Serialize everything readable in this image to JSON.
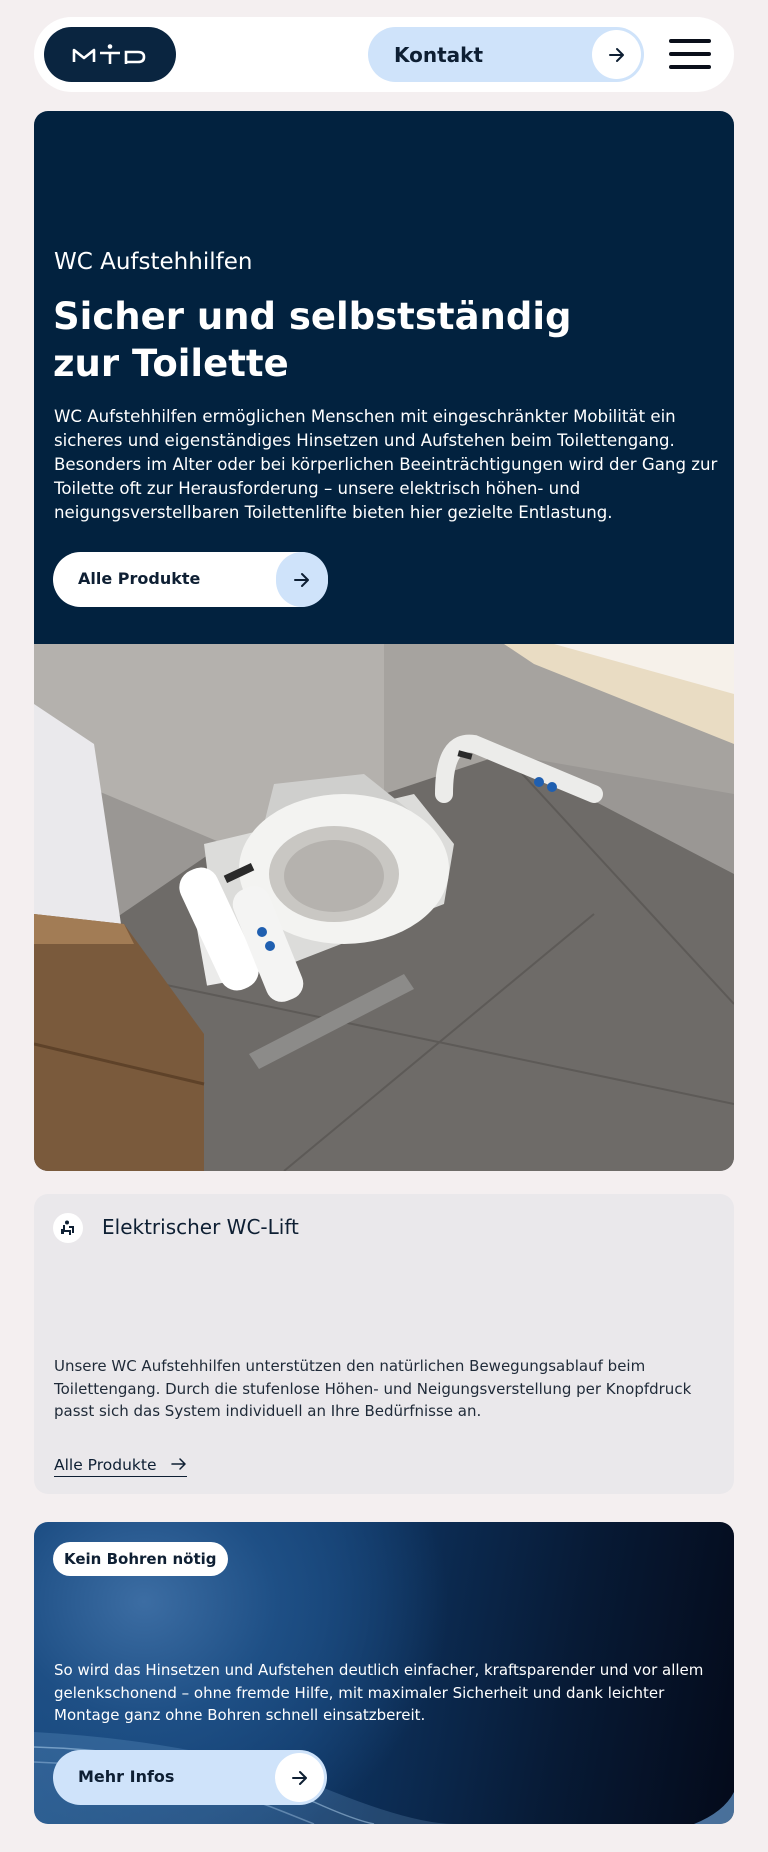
{
  "header": {
    "logo_text": "MTP",
    "contact_label": "Kontakt",
    "menu_icon": "hamburger-icon"
  },
  "hero": {
    "eyebrow": "WC Aufstehhilfen",
    "title_line1": "Sicher und selbstständig",
    "title_line2": "zur Toilette",
    "description": "WC Aufstehhilfen ermöglichen Menschen mit eingeschränkter Mobilität ein sicheres und eigenständiges Hinsetzen und Aufstehen beim Toilettengang. Besonders im Alter oder bei körperlichen Beeinträchtigungen wird der Gang zur Toilette oft zur Herausforderung – unsere elektrisch höhen- und neigungsverstellbaren Toilettenlifte bieten hier gezielte Entlastung.",
    "button_label": "Alle Produkte"
  },
  "feature_card": {
    "icon": "wc-lift-icon",
    "heading": "Elektrischer WC-Lift",
    "text": "Unsere WC Aufstehhilfen unterstützen den natürlichen Bewegungsablauf beim Toilettengang. Durch die stufenlose Höhen- und Neigungsverstellung per Knopfdruck passt sich das System individuell an Ihre Bedürfnisse an.",
    "link_label": "Alle Produkte"
  },
  "promo_card": {
    "tag": "Kein Bohren nötig",
    "text": "So wird das Hinsetzen und Aufstehen deutlich einfacher, kraftsparender und vor allem gelenkschonend – ohne fremde Hilfe, mit maximaler Sicherheit und dank leichter Montage ganz ohne Bohren schnell einsatzbereit.",
    "button_label": "Mehr Infos"
  },
  "colors": {
    "navy": "#02223f",
    "light_blue": "#cfe3fa",
    "page_bg": "#f4eff0",
    "card_bg": "#eae8eb"
  }
}
